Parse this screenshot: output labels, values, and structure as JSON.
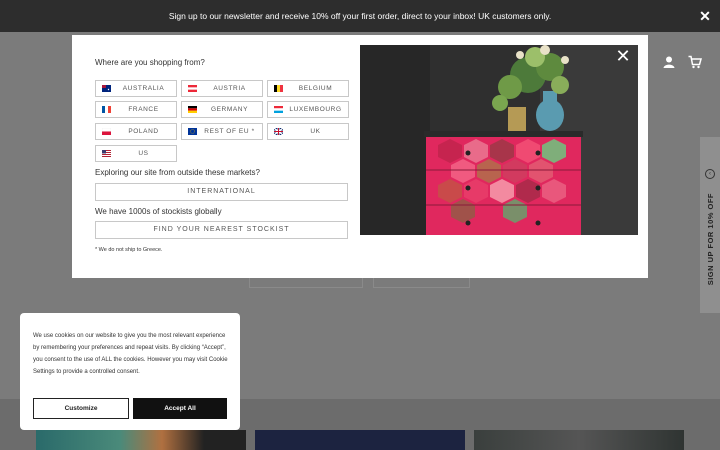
{
  "topbar": {
    "message": "Sign up to our newsletter and receive 10% off your first order, direct to your inbox! UK customers only.",
    "close_icon": "close-icon"
  },
  "sidetab": {
    "label": "SIGN UP FOR 10% OFF",
    "icon": "chevron-left-icon"
  },
  "modal": {
    "title": "Where are you shopping from?",
    "countries": [
      {
        "label": "AUSTRALIA",
        "icon": "flag-australia-icon"
      },
      {
        "label": "AUSTRIA",
        "icon": "flag-austria-icon"
      },
      {
        "label": "BELGIUM",
        "icon": "flag-belgium-icon"
      },
      {
        "label": "FRANCE",
        "icon": "flag-france-icon"
      },
      {
        "label": "GERMANY",
        "icon": "flag-germany-icon"
      },
      {
        "label": "LUXEMBOURG",
        "icon": "flag-luxembourg-icon"
      },
      {
        "label": "POLAND",
        "icon": "flag-poland-icon"
      },
      {
        "label": "REST OF EU *",
        "icon": "flag-eu-icon"
      },
      {
        "label": "UK",
        "icon": "flag-uk-icon"
      },
      {
        "label": "US",
        "icon": "flag-us-icon"
      }
    ],
    "outside_text": "Exploring our site from outside these markets?",
    "international_label": "INTERNATIONAL",
    "stockists_text": "We have 1000s of stockists globally",
    "stockist_label": "FIND YOUR NEAREST STOCKIST",
    "note": "* We do not ship to Greece.",
    "image_icon": "painted-dresser-photo",
    "close_icon": "close-icon"
  },
  "cookie": {
    "text": "We use cookies on our website to give you the most relevant experience by remembering your preferences and repeat visits. By clicking “Accept”, you consent to the use of ALL the cookies. However you may visit Cookie Settings to provide a controlled consent.",
    "customize_label": "Customize",
    "accept_label": "Accept All"
  },
  "colors": {
    "overlay": "#7b7b7b",
    "topbar": "#2d2d2d",
    "accent_dark": "#111111",
    "dresser_pink": "#e0285e"
  }
}
